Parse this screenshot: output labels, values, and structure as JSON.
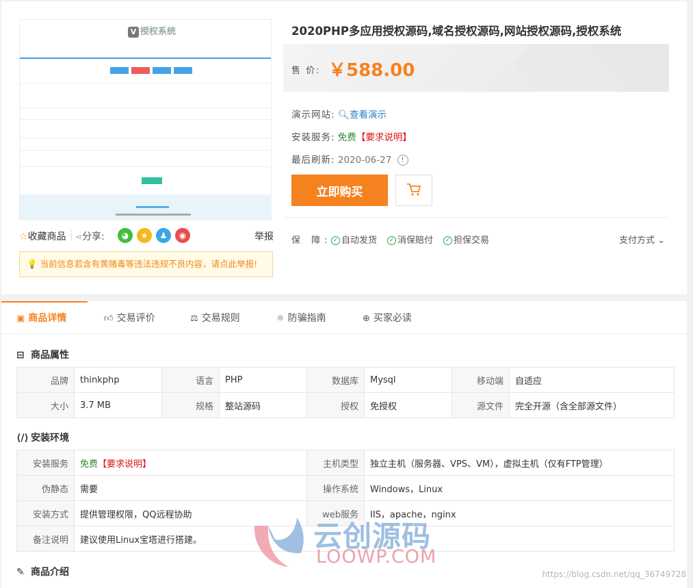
{
  "preview": {
    "logo_text": "授权系统",
    "logo_letter": "V"
  },
  "share": {
    "favorite_label": "收藏商品",
    "share_label": "分享:",
    "report_label": "举报",
    "icons": [
      "wechat-icon",
      "qzone-icon",
      "qq-icon",
      "weibo-icon"
    ]
  },
  "notice": "当前信息若含有黄赌毒等违法违规不良内容，请点此举报!",
  "product": {
    "title": "2020PHP多应用授权源码,域名授权源码,网站授权源码,授权系统",
    "price_label": "售  价:",
    "price": "￥588.00",
    "demo_label": "演示网站:",
    "demo_link": "查看演示",
    "install_label": "安装服务:",
    "install_free": "免费",
    "install_req": "【要求说明】",
    "update_label": "最后刷新:",
    "update_date": "2020-06-27",
    "update_info": "!",
    "buy_label": "立即购买"
  },
  "guarantee": {
    "label": "保  障:",
    "items": [
      "自动发货",
      "消保赔付",
      "担保交易"
    ],
    "payment": "支付方式"
  },
  "tabs": [
    {
      "label": "商品详情",
      "active": true
    },
    {
      "label": "交易评价",
      "active": false
    },
    {
      "label": "交易规则",
      "active": false
    },
    {
      "label": "防骗指南",
      "active": false
    },
    {
      "label": "买家必读",
      "active": false
    }
  ],
  "attributes": {
    "title": "商品属性",
    "rows": [
      [
        [
          "品牌",
          "thinkphp"
        ],
        [
          "语言",
          "PHP"
        ],
        [
          "数据库",
          "Mysql"
        ],
        [
          "移动端",
          "自适应"
        ]
      ],
      [
        [
          "大小",
          "3.7 MB"
        ],
        [
          "规格",
          "整站源码"
        ],
        [
          "授权",
          "免授权"
        ],
        [
          "源文件",
          "完全开源（含全部源文件）"
        ]
      ]
    ]
  },
  "environment": {
    "title": "安装环境",
    "rows": [
      {
        "k1": "安装服务",
        "v1_free": "免费",
        "v1_req": "【要求说明】",
        "k2": "主机类型",
        "v2": "独立主机（服务器、VPS、VM），虚拟主机（仅有FTP管理）"
      },
      {
        "k1": "伪静态",
        "v1": "需要",
        "k2": "操作系统",
        "v2": "Windows，Linux"
      },
      {
        "k1": "安装方式",
        "v1": "提供管理权限，QQ远程协助",
        "k2": "web服务",
        "v2": "IIS，apache，nginx"
      },
      {
        "k1": "备注说明",
        "v1": "建议使用Linux宝塔进行搭建。"
      }
    ]
  },
  "intro_title": "商品介绍",
  "watermark": {
    "cn": "云创源码",
    "en": "LOOWP.COM"
  },
  "csdn": "https://blog.csdn.net/qq_36749728"
}
